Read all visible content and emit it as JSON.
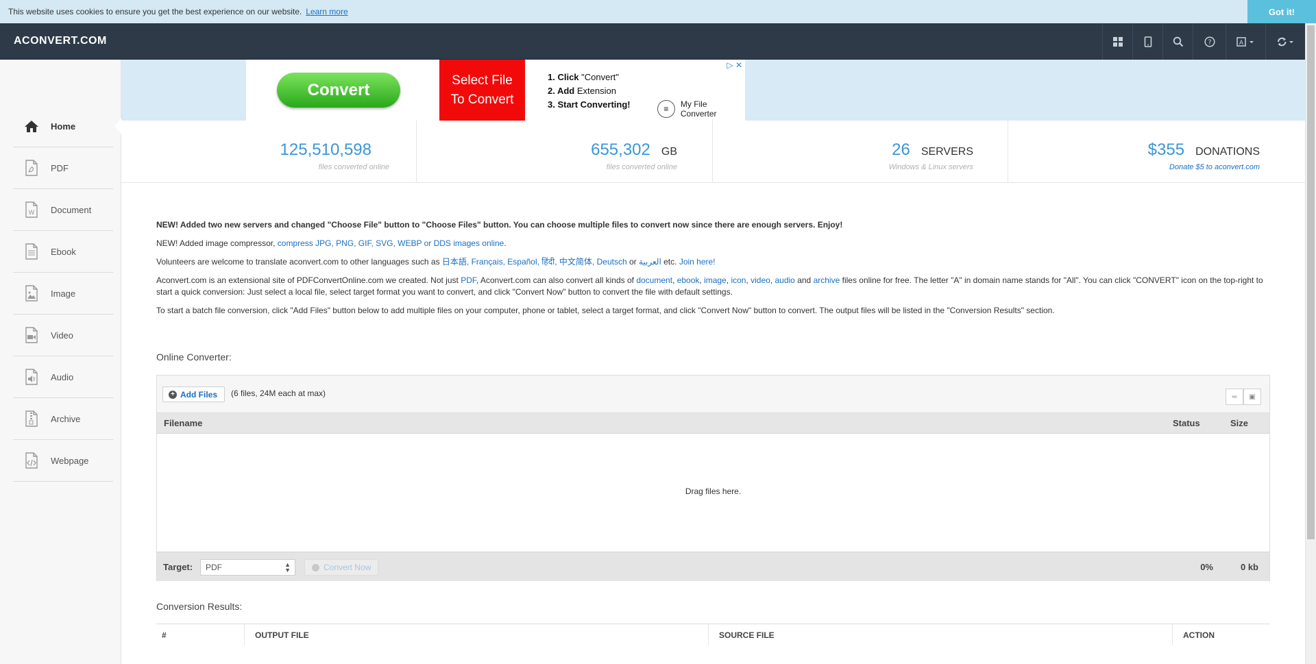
{
  "cookie": {
    "text": "This website uses cookies to ensure you get the best experience on our website.",
    "learn_more": "Learn more",
    "got_it": "Got it!"
  },
  "header": {
    "logo": "ACONVERT.COM",
    "icons": [
      "grid-icon",
      "mobile-icon",
      "search-icon",
      "help-icon",
      "language-icon",
      "refresh-icon"
    ]
  },
  "sidebar": {
    "items": [
      {
        "label": "Home",
        "icon": "home-icon",
        "active": true
      },
      {
        "label": "PDF",
        "icon": "pdf-file-icon"
      },
      {
        "label": "Document",
        "icon": "document-file-icon"
      },
      {
        "label": "Ebook",
        "icon": "ebook-file-icon"
      },
      {
        "label": "Image",
        "icon": "image-file-icon"
      },
      {
        "label": "Video",
        "icon": "video-file-icon"
      },
      {
        "label": "Audio",
        "icon": "audio-file-icon"
      },
      {
        "label": "Archive",
        "icon": "archive-file-icon"
      },
      {
        "label": "Webpage",
        "icon": "webpage-file-icon"
      }
    ]
  },
  "ad": {
    "button": "Convert",
    "red_line1": "Select File",
    "red_line2": "To Convert",
    "step1_bold": "1. Click",
    "step1_rest": "\"Convert\"",
    "step2_bold": "2. Add",
    "step2_rest": "Extension",
    "step3": "3. Start Converting!",
    "brand": "My File Converter"
  },
  "stats": [
    {
      "value": "125,510,598",
      "unit": "",
      "sub": "files converted online"
    },
    {
      "value": "655,302",
      "unit": "GB",
      "sub": "files converted online"
    },
    {
      "value": "26",
      "unit": "SERVERS",
      "sub": "Windows & Linux servers"
    },
    {
      "value": "$355",
      "unit": "DONATIONS",
      "sub": "Donate $5 to aconvert.com"
    }
  ],
  "news": {
    "p1": "NEW! Added two new servers and changed \"Choose File\" button to \"Choose Files\" button. You can choose multiple files to convert now since there are enough servers. Enjoy!",
    "p2_text": "NEW! Added image compressor,",
    "p2_link": "compress JPG, PNG, GIF, SVG, WEBP or DDS images online",
    "p3_text": "Volunteers are welcome to translate aconvert.com to other languages such as",
    "p3_langs": "日本語, Français, Español, हिंदी, 中文简体, Deutsch",
    "p3_or": "or",
    "p3_ar": "العربية",
    "p3_etc": "etc.",
    "p3_join": "Join here!",
    "p4_a": "Aconvert.com is an extensional site of PDFConvertOnline.com we created. Not just",
    "p4_pdf": "PDF",
    "p4_b": ", Aconvert.com can also convert all kinds of",
    "p4_document": "document",
    "p4_ebook": "ebook",
    "p4_image": "image",
    "p4_icon": "icon",
    "p4_video": "video",
    "p4_audio": "audio",
    "p4_and": "and",
    "p4_archive": "archive",
    "p4_c": "files online for free. The letter \"A\" in domain name stands for \"All\". You can click \"CONVERT\" icon on the top-right to start a quick conversion: Just select a local file, select target format you want to convert, and click \"Convert Now\" button to convert the file with default settings.",
    "p5": "To start a batch file conversion, click \"Add Files\" button below to add multiple files on your computer, phone or tablet, select a target format, and click \"Convert Now\" button to convert. The output files will be listed in the \"Conversion Results\" section."
  },
  "converter": {
    "title": "Online Converter:",
    "add_files": "Add Files",
    "files_note": "(6 files, 24M each at max)",
    "col_filename": "Filename",
    "col_status": "Status",
    "col_size": "Size",
    "drag_text": "Drag files here.",
    "target_label": "Target:",
    "target_value": "PDF",
    "convert_now": "Convert Now",
    "percent": "0%",
    "size_total": "0 kb"
  },
  "results": {
    "title": "Conversion Results:",
    "col_num": "#",
    "col_output": "OUTPUT FILE",
    "col_source": "SOURCE FILE",
    "col_action": "ACTION"
  },
  "colors": {
    "accent": "#3a96d8",
    "header_bg": "#2e3a48",
    "cookie_bg": "#d4e9f4",
    "got_it_bg": "#5bc0de",
    "ad_red": "#f20a0a"
  }
}
